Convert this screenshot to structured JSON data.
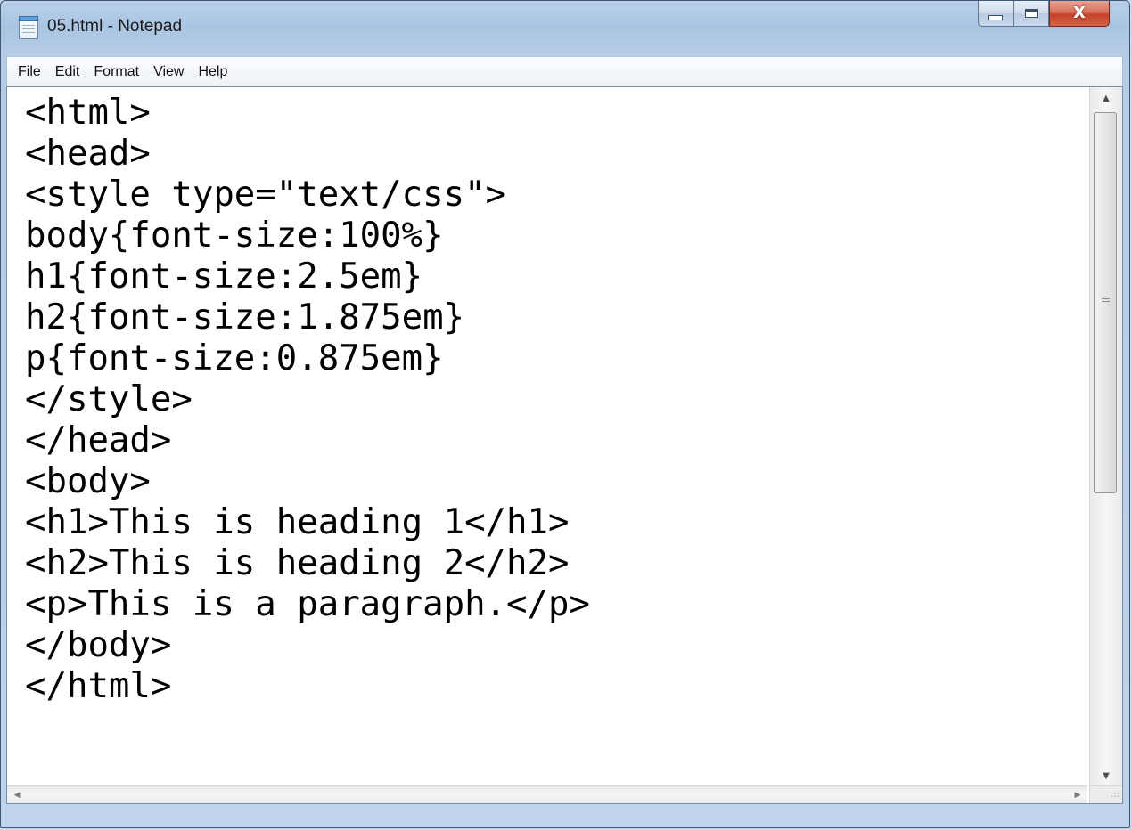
{
  "window": {
    "title": "05.html - Notepad",
    "icon": "notepad-icon",
    "controls": {
      "minimize_icon": "minimize-icon",
      "maximize_icon": "maximize-icon",
      "close_glyph": "X"
    }
  },
  "menubar": {
    "items": [
      {
        "accel": "F",
        "rest": "ile"
      },
      {
        "accel": "E",
        "rest": "dit"
      },
      {
        "pre": "F",
        "accel": "o",
        "rest": "rmat"
      },
      {
        "accel": "V",
        "rest": "iew"
      },
      {
        "accel": "H",
        "rest": "elp"
      }
    ]
  },
  "editor": {
    "lines": [
      "<html>",
      "<head>",
      "<style type=\"text/css\">",
      "body{font-size:100%}",
      "h1{font-size:2.5em}",
      "h2{font-size:1.875em}",
      "p{font-size:0.875em}",
      "</style>",
      "</head>",
      "<body>",
      "<h1>This is heading 1</h1>",
      "<h2>This is heading 2</h2>",
      "<p>This is a paragraph.</p>",
      "</body>",
      "</html>"
    ]
  },
  "scrollbars": {
    "up_arrow": "▲",
    "down_arrow": "▼",
    "left_arrow": "◀",
    "right_arrow": "▶",
    "size_grip": ".::"
  }
}
